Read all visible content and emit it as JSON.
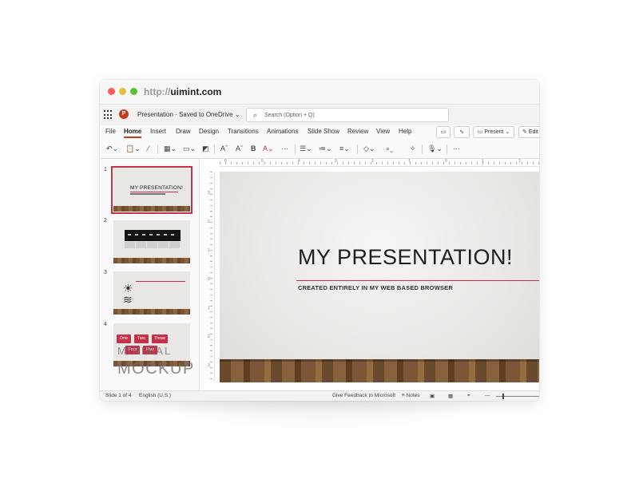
{
  "browser": {
    "protocol": "http://",
    "domain": "uimint.com"
  },
  "app": {
    "logo_letter": "P",
    "doc_title": "Presentation  ·  Saved to OneDrive ⌄",
    "search_placeholder": "Search (Option + Q)"
  },
  "ribbon": {
    "tabs": [
      "File",
      "Home",
      "Insert",
      "Draw",
      "Design",
      "Transitions",
      "Animations",
      "Slide Show",
      "Review",
      "View",
      "Help"
    ],
    "active_tab": "Home",
    "present_label": "Present",
    "edit_label": "Edit"
  },
  "toolbar": {
    "icons": [
      "undo-icon",
      "paste-icon",
      "format-painter-icon",
      "new-slide-icon",
      "layout-icon",
      "reset-icon",
      "font-size-up-icon",
      "font-size-down-icon",
      "bold-icon",
      "font-color-icon",
      "more-icon",
      "bullets-icon",
      "numbering-icon",
      "align-icon",
      "shapes-icon",
      "find-icon",
      "designer-icon",
      "dictate-icon",
      "overflow-icon"
    ],
    "glyphs": {
      "undo": "↶⌄",
      "paste": "📋⌄",
      "brush": "⁄",
      "newslide": "▦⌄",
      "layout": "▭⌄",
      "reset": "◩",
      "grow": "Aˆ",
      "shrink": "Aˇ",
      "bold": "B",
      "fontcolor": "A⌄",
      "more": "···",
      "bullets": "☰⌄",
      "numbering": "≔⌄",
      "align": "≡⌄",
      "shapes": "◇⌄",
      "find": "⌕⌄",
      "designer": "✧",
      "dictate": "🎙⌄",
      "overflow": "···"
    }
  },
  "ruler": {
    "h_numbers": [
      "6",
      "5",
      "4",
      "3",
      "2",
      "1",
      "0",
      "1",
      "2",
      "3"
    ],
    "v_numbers": [
      "3",
      "2",
      "1",
      "0",
      "1",
      "2",
      "3"
    ]
  },
  "thumbnails": {
    "numbers": [
      "1",
      "2",
      "3",
      "4"
    ],
    "slide1_title": "MY PRESENTATION!",
    "slide4_chips": [
      "One",
      "Two",
      "Three",
      "Four",
      "Five"
    ]
  },
  "slide": {
    "title": "MY PRESENTATION!",
    "subtitle": "CREATED ENTIRELY IN MY WEB BASED BROWSER",
    "accent_color": "#c4314b"
  },
  "watermark": {
    "line1": "MINIMAL",
    "line2": "MOCKUP"
  },
  "status": {
    "slide_info": "Slide 1 of 4",
    "language": "English (U.S.)",
    "feedback": "Give Feedback to Microsoft",
    "notes": "Notes"
  }
}
